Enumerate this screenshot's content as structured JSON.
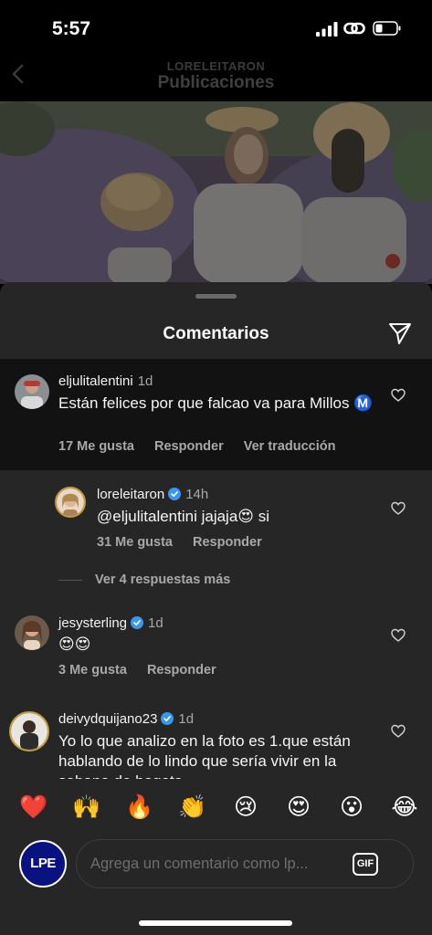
{
  "status_bar": {
    "time": "5:57"
  },
  "header": {
    "username": "LORELEITARON",
    "title": "Publicaciones"
  },
  "sheet": {
    "title": "Comentarios"
  },
  "comments": [
    {
      "username": "eljulitalentini",
      "age": "1d",
      "text": "Están felices por que falcao va para Millos Ⓜ️",
      "likes": "17 Me gusta",
      "reply": "Responder",
      "translate": "Ver traducción"
    },
    {
      "username": "loreleitaron",
      "verified": true,
      "age": "14h",
      "text": "@eljulitalentini jajaja😍 si",
      "likes": "31 Me gusta",
      "reply": "Responder"
    },
    {
      "username": "jesysterling",
      "verified": true,
      "age": "1d",
      "text": "😍😍",
      "likes": "3 Me gusta",
      "reply": "Responder"
    },
    {
      "username": "deivydquijano23",
      "verified": true,
      "age": "1d",
      "text": "Yo lo que analizo en la foto es 1.que están hablando de lo lindo que sería vivir en la sabana de bogota"
    }
  ],
  "more_replies": "Ver 4 respuestas más",
  "quick_emojis": [
    "❤️",
    "🙌",
    "🔥",
    "👏",
    "😢",
    "😍",
    "😮",
    "😂"
  ],
  "composer": {
    "avatar_text": "LPE",
    "placeholder": "Agrega un comentario como lp...",
    "gif_label": "GIF"
  },
  "colors": {
    "sheet_bg": "#262626",
    "highlight_bg": "#121212",
    "verified": "#3897f0",
    "muted_text": "#a8a8a8"
  }
}
